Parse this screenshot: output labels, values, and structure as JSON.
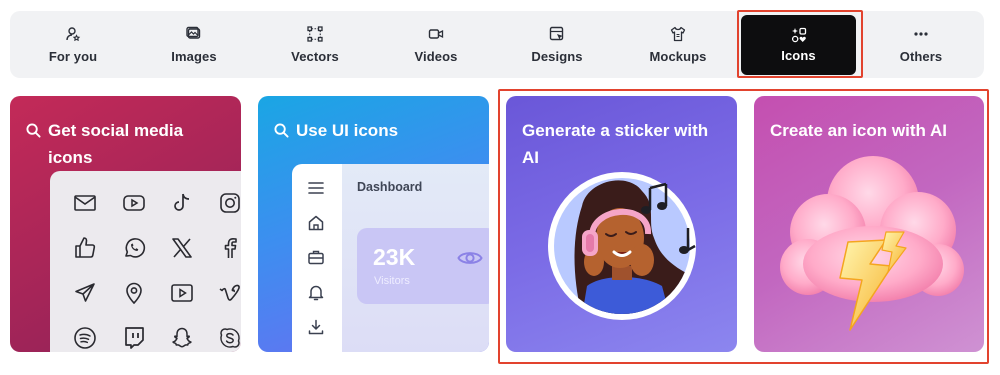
{
  "tabs": [
    {
      "label": "For you",
      "icon": "user-star-icon",
      "active": false
    },
    {
      "label": "Images",
      "icon": "image-icon",
      "active": false
    },
    {
      "label": "Vectors",
      "icon": "vector-nodes-icon",
      "active": false
    },
    {
      "label": "Videos",
      "icon": "video-camera-icon",
      "active": false
    },
    {
      "label": "Designs",
      "icon": "design-icon",
      "active": false
    },
    {
      "label": "Mockups",
      "icon": "mockup-shirt-icon",
      "active": false
    },
    {
      "label": "Icons",
      "icon": "icons-shapes-icon",
      "active": true
    },
    {
      "label": "Others",
      "icon": "more-dots-icon",
      "active": false
    }
  ],
  "cards": {
    "social": {
      "title": "Get social media icons"
    },
    "ui": {
      "title": "Use UI icons",
      "dashboard_label": "Dashboard",
      "stat_value": "23K",
      "stat_label": "Visitors"
    },
    "sticker": {
      "title": "Generate a sticker with AI"
    },
    "ai_icon": {
      "title": "Create an icon with AI"
    }
  },
  "social_icons": [
    "mail-icon",
    "youtube-icon",
    "tiktok-icon",
    "instagram-icon",
    "thumbs-up-icon",
    "whatsapp-icon",
    "x-logo-icon",
    "facebook-icon",
    "send-icon",
    "location-pin-icon",
    "play-button-icon",
    "vimeo-icon",
    "spotify-icon",
    "twitch-icon",
    "snapchat-icon",
    "skype-icon"
  ],
  "colors": {
    "highlight": "#e2432e",
    "active_tab": "#0d0d0f",
    "tab_bar": "#f1f2f4"
  }
}
